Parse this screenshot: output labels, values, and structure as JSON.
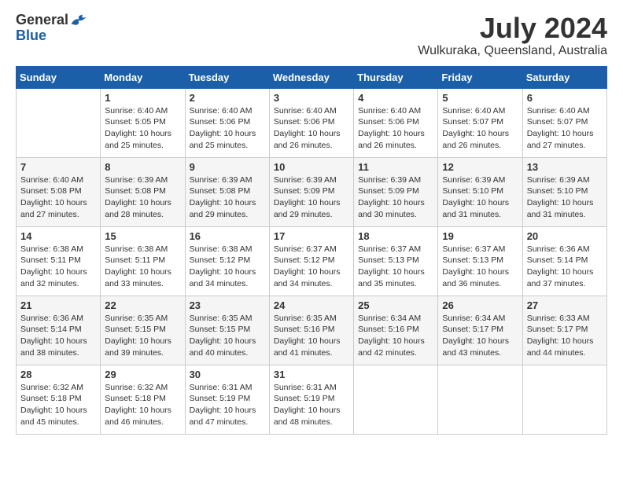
{
  "header": {
    "logo_general": "General",
    "logo_blue": "Blue",
    "month_title": "July 2024",
    "location": "Wulkuraka, Queensland, Australia"
  },
  "weekdays": [
    "Sunday",
    "Monday",
    "Tuesday",
    "Wednesday",
    "Thursday",
    "Friday",
    "Saturday"
  ],
  "weeks": [
    [
      {
        "day": "",
        "sunrise": "",
        "sunset": "",
        "daylight": ""
      },
      {
        "day": "1",
        "sunrise": "Sunrise: 6:40 AM",
        "sunset": "Sunset: 5:05 PM",
        "daylight": "Daylight: 10 hours and 25 minutes."
      },
      {
        "day": "2",
        "sunrise": "Sunrise: 6:40 AM",
        "sunset": "Sunset: 5:06 PM",
        "daylight": "Daylight: 10 hours and 25 minutes."
      },
      {
        "day": "3",
        "sunrise": "Sunrise: 6:40 AM",
        "sunset": "Sunset: 5:06 PM",
        "daylight": "Daylight: 10 hours and 26 minutes."
      },
      {
        "day": "4",
        "sunrise": "Sunrise: 6:40 AM",
        "sunset": "Sunset: 5:06 PM",
        "daylight": "Daylight: 10 hours and 26 minutes."
      },
      {
        "day": "5",
        "sunrise": "Sunrise: 6:40 AM",
        "sunset": "Sunset: 5:07 PM",
        "daylight": "Daylight: 10 hours and 26 minutes."
      },
      {
        "day": "6",
        "sunrise": "Sunrise: 6:40 AM",
        "sunset": "Sunset: 5:07 PM",
        "daylight": "Daylight: 10 hours and 27 minutes."
      }
    ],
    [
      {
        "day": "7",
        "sunrise": "Sunrise: 6:40 AM",
        "sunset": "Sunset: 5:08 PM",
        "daylight": "Daylight: 10 hours and 27 minutes."
      },
      {
        "day": "8",
        "sunrise": "Sunrise: 6:39 AM",
        "sunset": "Sunset: 5:08 PM",
        "daylight": "Daylight: 10 hours and 28 minutes."
      },
      {
        "day": "9",
        "sunrise": "Sunrise: 6:39 AM",
        "sunset": "Sunset: 5:08 PM",
        "daylight": "Daylight: 10 hours and 29 minutes."
      },
      {
        "day": "10",
        "sunrise": "Sunrise: 6:39 AM",
        "sunset": "Sunset: 5:09 PM",
        "daylight": "Daylight: 10 hours and 29 minutes."
      },
      {
        "day": "11",
        "sunrise": "Sunrise: 6:39 AM",
        "sunset": "Sunset: 5:09 PM",
        "daylight": "Daylight: 10 hours and 30 minutes."
      },
      {
        "day": "12",
        "sunrise": "Sunrise: 6:39 AM",
        "sunset": "Sunset: 5:10 PM",
        "daylight": "Daylight: 10 hours and 31 minutes."
      },
      {
        "day": "13",
        "sunrise": "Sunrise: 6:39 AM",
        "sunset": "Sunset: 5:10 PM",
        "daylight": "Daylight: 10 hours and 31 minutes."
      }
    ],
    [
      {
        "day": "14",
        "sunrise": "Sunrise: 6:38 AM",
        "sunset": "Sunset: 5:11 PM",
        "daylight": "Daylight: 10 hours and 32 minutes."
      },
      {
        "day": "15",
        "sunrise": "Sunrise: 6:38 AM",
        "sunset": "Sunset: 5:11 PM",
        "daylight": "Daylight: 10 hours and 33 minutes."
      },
      {
        "day": "16",
        "sunrise": "Sunrise: 6:38 AM",
        "sunset": "Sunset: 5:12 PM",
        "daylight": "Daylight: 10 hours and 34 minutes."
      },
      {
        "day": "17",
        "sunrise": "Sunrise: 6:37 AM",
        "sunset": "Sunset: 5:12 PM",
        "daylight": "Daylight: 10 hours and 34 minutes."
      },
      {
        "day": "18",
        "sunrise": "Sunrise: 6:37 AM",
        "sunset": "Sunset: 5:13 PM",
        "daylight": "Daylight: 10 hours and 35 minutes."
      },
      {
        "day": "19",
        "sunrise": "Sunrise: 6:37 AM",
        "sunset": "Sunset: 5:13 PM",
        "daylight": "Daylight: 10 hours and 36 minutes."
      },
      {
        "day": "20",
        "sunrise": "Sunrise: 6:36 AM",
        "sunset": "Sunset: 5:14 PM",
        "daylight": "Daylight: 10 hours and 37 minutes."
      }
    ],
    [
      {
        "day": "21",
        "sunrise": "Sunrise: 6:36 AM",
        "sunset": "Sunset: 5:14 PM",
        "daylight": "Daylight: 10 hours and 38 minutes."
      },
      {
        "day": "22",
        "sunrise": "Sunrise: 6:35 AM",
        "sunset": "Sunset: 5:15 PM",
        "daylight": "Daylight: 10 hours and 39 minutes."
      },
      {
        "day": "23",
        "sunrise": "Sunrise: 6:35 AM",
        "sunset": "Sunset: 5:15 PM",
        "daylight": "Daylight: 10 hours and 40 minutes."
      },
      {
        "day": "24",
        "sunrise": "Sunrise: 6:35 AM",
        "sunset": "Sunset: 5:16 PM",
        "daylight": "Daylight: 10 hours and 41 minutes."
      },
      {
        "day": "25",
        "sunrise": "Sunrise: 6:34 AM",
        "sunset": "Sunset: 5:16 PM",
        "daylight": "Daylight: 10 hours and 42 minutes."
      },
      {
        "day": "26",
        "sunrise": "Sunrise: 6:34 AM",
        "sunset": "Sunset: 5:17 PM",
        "daylight": "Daylight: 10 hours and 43 minutes."
      },
      {
        "day": "27",
        "sunrise": "Sunrise: 6:33 AM",
        "sunset": "Sunset: 5:17 PM",
        "daylight": "Daylight: 10 hours and 44 minutes."
      }
    ],
    [
      {
        "day": "28",
        "sunrise": "Sunrise: 6:32 AM",
        "sunset": "Sunset: 5:18 PM",
        "daylight": "Daylight: 10 hours and 45 minutes."
      },
      {
        "day": "29",
        "sunrise": "Sunrise: 6:32 AM",
        "sunset": "Sunset: 5:18 PM",
        "daylight": "Daylight: 10 hours and 46 minutes."
      },
      {
        "day": "30",
        "sunrise": "Sunrise: 6:31 AM",
        "sunset": "Sunset: 5:19 PM",
        "daylight": "Daylight: 10 hours and 47 minutes."
      },
      {
        "day": "31",
        "sunrise": "Sunrise: 6:31 AM",
        "sunset": "Sunset: 5:19 PM",
        "daylight": "Daylight: 10 hours and 48 minutes."
      },
      {
        "day": "",
        "sunrise": "",
        "sunset": "",
        "daylight": ""
      },
      {
        "day": "",
        "sunrise": "",
        "sunset": "",
        "daylight": ""
      },
      {
        "day": "",
        "sunrise": "",
        "sunset": "",
        "daylight": ""
      }
    ]
  ]
}
